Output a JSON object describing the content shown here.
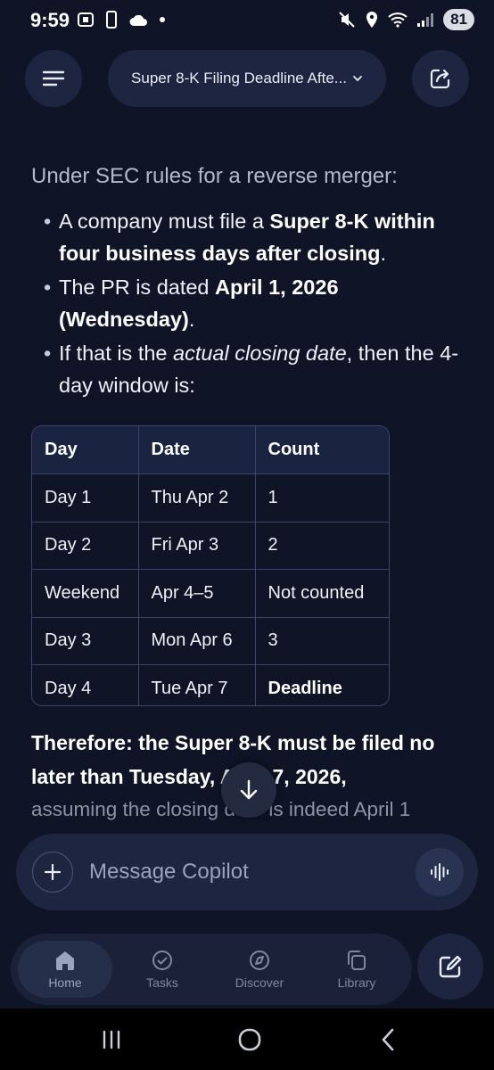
{
  "status_bar": {
    "time": "9:59",
    "battery": "81"
  },
  "header": {
    "title": "Super 8-K Filing Deadline Afte..."
  },
  "message": {
    "intro": "Under SEC rules for a reverse merger:",
    "bullets": [
      {
        "pre": "A company must file a ",
        "bold": "Super 8-K within four business days after closing",
        "post": "."
      },
      {
        "pre": "The PR is dated ",
        "bold": "April 1, 2026 (Wednesday)",
        "post": "."
      },
      {
        "pre": "If that is the ",
        "italic": "actual closing date",
        "post": ", then the 4-day window is:"
      }
    ],
    "table": {
      "headers": [
        "Day",
        "Date",
        "Count"
      ],
      "rows": [
        [
          "Day 1",
          "Thu Apr 2",
          "1"
        ],
        [
          "Day 2",
          "Fri Apr 3",
          "2"
        ],
        [
          "Weekend",
          "Apr 4–5",
          "Not counted"
        ],
        [
          "Day 3",
          "Mon Apr 6",
          "3"
        ],
        [
          "Day 4",
          "Tue Apr 7",
          "Deadline"
        ]
      ]
    },
    "conclusion": "Therefore: the Super 8-K must be filed no later than Tuesday, April 7, 2026,",
    "assumption": "assuming the closing date is indeed April 1"
  },
  "composer": {
    "placeholder": "Message Copilot"
  },
  "nav": {
    "items": [
      {
        "label": "Home",
        "icon": "home-icon",
        "active": true
      },
      {
        "label": "Tasks",
        "icon": "check-circle-icon",
        "active": false
      },
      {
        "label": "Discover",
        "icon": "compass-icon",
        "active": false
      },
      {
        "label": "Library",
        "icon": "library-icon",
        "active": false
      }
    ]
  },
  "colors": {
    "background": "#0f1526",
    "surface": "#1d2540",
    "table_border": "#3a4768",
    "muted_text": "#8c93a6"
  }
}
